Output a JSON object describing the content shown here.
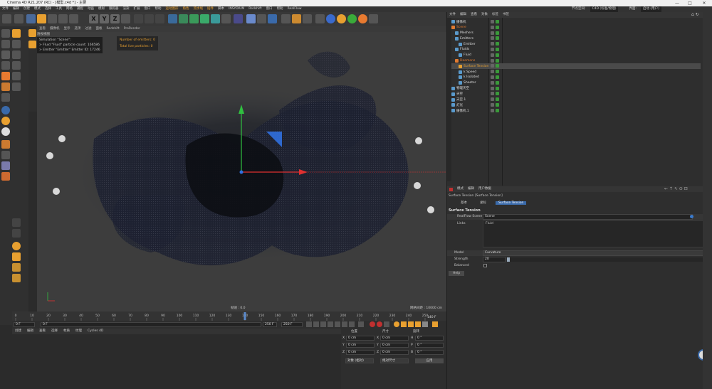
{
  "window": {
    "title": "Cinema 4D R21.207 (RC) - [模型.c4d *] - 主要",
    "minimize": "—",
    "maximize": "□",
    "close": "✕"
  },
  "menubar": {
    "items": [
      "文件",
      "编辑",
      "创建",
      "模式",
      "选择",
      "工具",
      "网格",
      "捕捉",
      "动画",
      "模拟",
      "跟踪器",
      "渲染",
      "扩展",
      "窗口",
      "帮助"
    ],
    "highlight_items": [
      "运动图形",
      "角色",
      "流水线",
      "插件",
      "脚本",
      "INSYDIUM",
      "Redshift",
      "窗口",
      "帮助",
      "RealFlow"
    ],
    "layout_label": "界面:",
    "layout_value": "启动 (用户)",
    "node_space_label": "节点空间:",
    "node_space_value": "C4D (标准/物理)"
  },
  "toolbar": {
    "xyz": [
      "X",
      "Y",
      "Z"
    ]
  },
  "viewport": {
    "menu": [
      "查看",
      "摄像机",
      "显示",
      "选项",
      "过滤",
      "面板",
      "Redshift",
      "ProRender"
    ],
    "panel_label": "透视视图",
    "sim_lines": [
      "Simulation \"Scene\":",
      "> Fluid \"Fluid\" particle count: 166586",
      "> Emitter \"Emitter\" Emitter ID: 17246"
    ],
    "hud_lines": [
      "Number of emitters: 0",
      "Total live particles: 0"
    ],
    "speed": "帧速 : 0.0",
    "grid_size": "网格间距 : 10000 cm"
  },
  "timeline": {
    "ticks": [
      "0",
      "10",
      "20",
      "30",
      "40",
      "50",
      "60",
      "70",
      "80",
      "90",
      "100",
      "110",
      "120",
      "130",
      "140",
      "150",
      "160",
      "170",
      "180",
      "190",
      "200",
      "210",
      "220",
      "230",
      "240",
      "250"
    ],
    "current": "140 F",
    "current_value": 140,
    "max_value": 250
  },
  "playbar": {
    "start": "0 F",
    "start2": "0 F",
    "end": "250 F",
    "end2": "250 F"
  },
  "materials": {
    "menu": [
      "创建",
      "编辑",
      "查看",
      "选择",
      "材质",
      "纹理",
      "Cycles 4D"
    ]
  },
  "coords": {
    "headers": [
      "位置",
      "尺寸",
      "旋转"
    ],
    "rows": [
      {
        "axis": "X",
        "pos": "0 cm",
        "sizeAxis": "X",
        "size": "0 cm",
        "rotAxis": "H",
        "rot": "0 °"
      },
      {
        "axis": "Y",
        "pos": "0 cm",
        "sizeAxis": "Y",
        "size": "0 cm",
        "rotAxis": "P",
        "rot": "0 °"
      },
      {
        "axis": "Z",
        "pos": "0 cm",
        "sizeAxis": "Z",
        "size": "0 cm",
        "rotAxis": "B",
        "rot": "0 °"
      }
    ],
    "mode": "对象 (相对)",
    "size_mode": "绝对尺寸",
    "apply": "应用"
  },
  "objmgr": {
    "menu": [
      "文件",
      "编辑",
      "查看",
      "对象",
      "标签",
      "书签"
    ],
    "items": [
      {
        "label": "摄像机",
        "depth": 0,
        "color": "#ddd"
      },
      {
        "label": "Scene",
        "depth": 0,
        "color": "#e07a30"
      },
      {
        "label": "Meshers",
        "depth": 1,
        "color": "#ddd"
      },
      {
        "label": "Emitters",
        "depth": 1,
        "color": "#ddd"
      },
      {
        "label": "Emitter",
        "depth": 2,
        "color": "#ddd"
      },
      {
        "label": "Fluids",
        "depth": 1,
        "color": "#ddd"
      },
      {
        "label": "Fluid",
        "depth": 2,
        "color": "#ddd"
      },
      {
        "label": "Daemons",
        "depth": 1,
        "color": "#e07a30"
      },
      {
        "label": "Surface Tension",
        "depth": 2,
        "color": "#e8a030",
        "selected": true
      },
      {
        "label": "k Speed",
        "depth": 2,
        "color": "#ddd"
      },
      {
        "label": "k Isolated",
        "depth": 2,
        "color": "#ddd"
      },
      {
        "label": "Sheeter",
        "depth": 2,
        "color": "#ddd"
      },
      {
        "label": "物理天空",
        "depth": 0,
        "color": "#ddd"
      },
      {
        "label": "天空",
        "depth": 0,
        "color": "#ddd"
      },
      {
        "label": "天空.1",
        "depth": 0,
        "color": "#ddd"
      },
      {
        "label": "灯光",
        "depth": 0,
        "color": "#ddd"
      },
      {
        "label": "摄像机.1",
        "depth": 0,
        "color": "#ddd"
      }
    ]
  },
  "attr": {
    "menu": [
      "模式",
      "编辑",
      "用户数据"
    ],
    "object_title": "Surface Tension [Surface Tension]",
    "tabs": [
      "基本",
      "坐标",
      "Surface Tension"
    ],
    "section": "Surface Tension",
    "scene_label": "RealFlow Scene",
    "scene_value": "Scene",
    "links_label": "Links",
    "links_value": "Fluid",
    "model_label": "Model",
    "model_value": "Curvature",
    "strength_label": "Strength",
    "strength_value": "20",
    "balanced_label": "Balanced",
    "help": "Help"
  },
  "colors": {
    "accent": "#e8a030",
    "axis_x": "#e03030",
    "axis_y": "#30c040",
    "axis_z": "#3070e0",
    "fluid": "#141820"
  }
}
